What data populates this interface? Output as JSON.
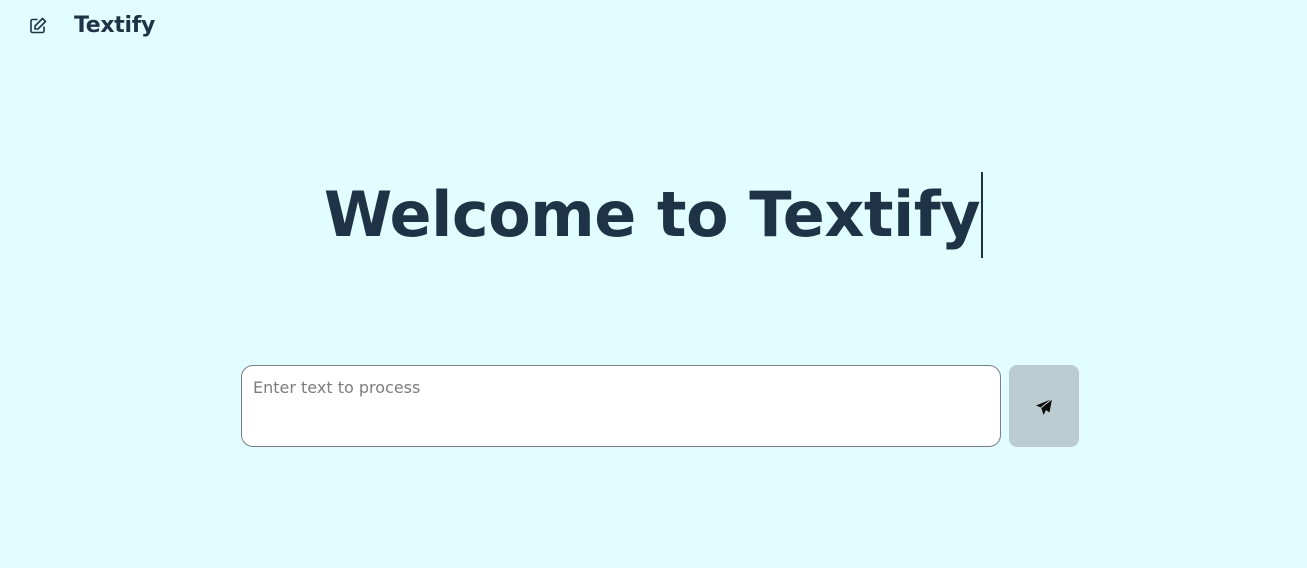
{
  "header": {
    "app_name": "Textify",
    "new_icon": "edit-icon"
  },
  "hero": {
    "title": "Welcome to Textify"
  },
  "composer": {
    "placeholder": "Enter text to process",
    "value": "",
    "send_icon": "paper-plane-icon"
  },
  "colors": {
    "background": "#e1fdff",
    "text": "#1f3347",
    "send_button": "#bccdd1",
    "input_background": "#ffffff"
  }
}
